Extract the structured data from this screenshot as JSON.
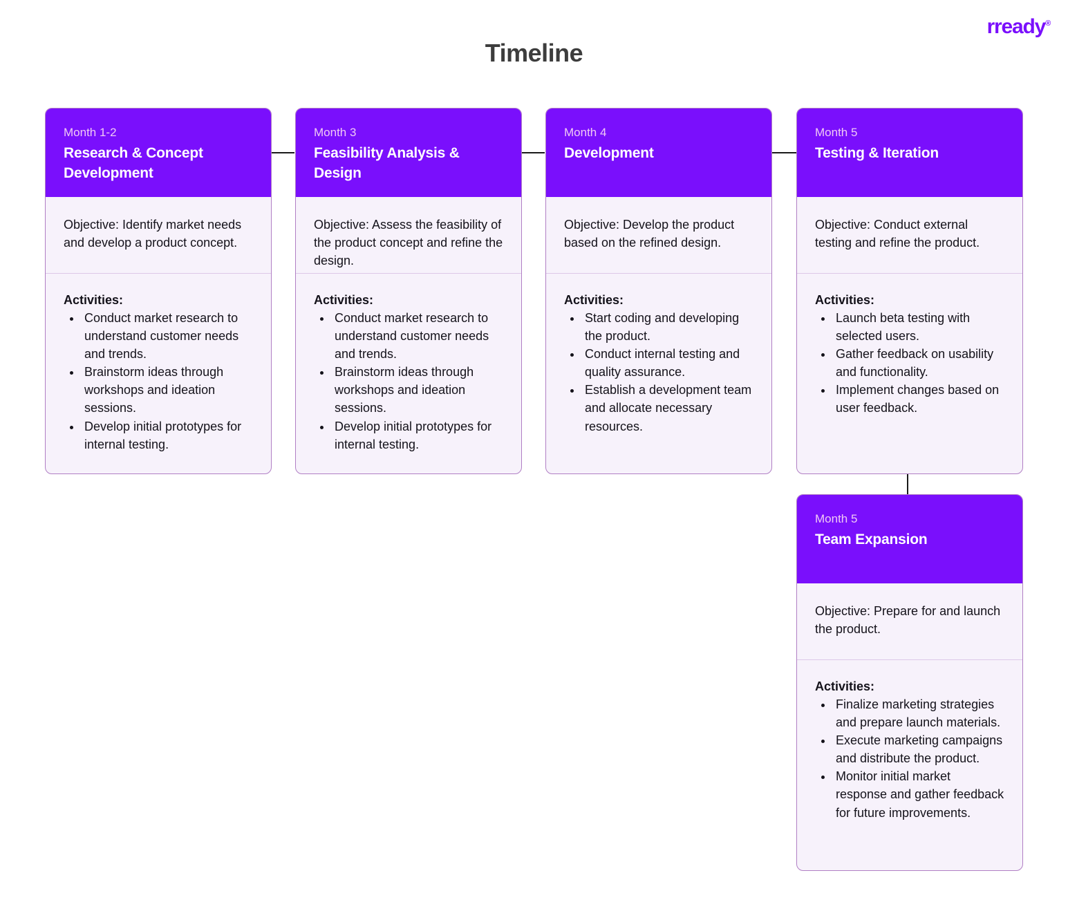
{
  "header": {
    "title": "Timeline",
    "logo_text": "rready",
    "logo_mark": "®",
    "accent_color": "#7a0ffc",
    "title_color": "#3d3d3d"
  },
  "labels": {
    "activities_heading": "Activities:"
  },
  "cards": [
    {
      "month": "Month 1-2",
      "title": "Research & Concept Development",
      "objective": "Objective: Identify market needs and develop a product concept.",
      "activities": [
        "Conduct market research to understand customer needs and trends.",
        "Brainstorm ideas through workshops and ideation sessions.",
        "Develop initial prototypes for internal testing."
      ]
    },
    {
      "month": "Month 3",
      "title": "Feasibility Analysis & Design",
      "objective": "Objective: Assess the feasibility of the product concept and refine the design.",
      "activities": [
        "Conduct market research to understand customer needs and trends.",
        "Brainstorm ideas through workshops and ideation sessions.",
        "Develop initial prototypes for internal testing."
      ]
    },
    {
      "month": "Month 4",
      "title": "Development",
      "objective": "Objective: Develop the product based on the refined design.",
      "activities": [
        "Start coding and developing the product.",
        "Conduct internal testing and quality assurance.",
        "Establish a development team and allocate necessary resources."
      ]
    },
    {
      "month": "Month 5",
      "title": "Testing & Iteration",
      "objective": "Objective: Conduct external testing and refine the product.",
      "activities": [
        "Launch beta testing with selected users.",
        "Gather feedback on usability and functionality.",
        "Implement changes based on user feedback."
      ]
    },
    {
      "month": "Month 5",
      "title": "Team Expansion",
      "objective": "Objective: Prepare for and launch the product.",
      "activities": [
        "Finalize marketing strategies and prepare launch materials.",
        "Execute marketing campaigns and distribute the product.",
        "Monitor initial market response and gather feedback for future improvements."
      ]
    }
  ]
}
